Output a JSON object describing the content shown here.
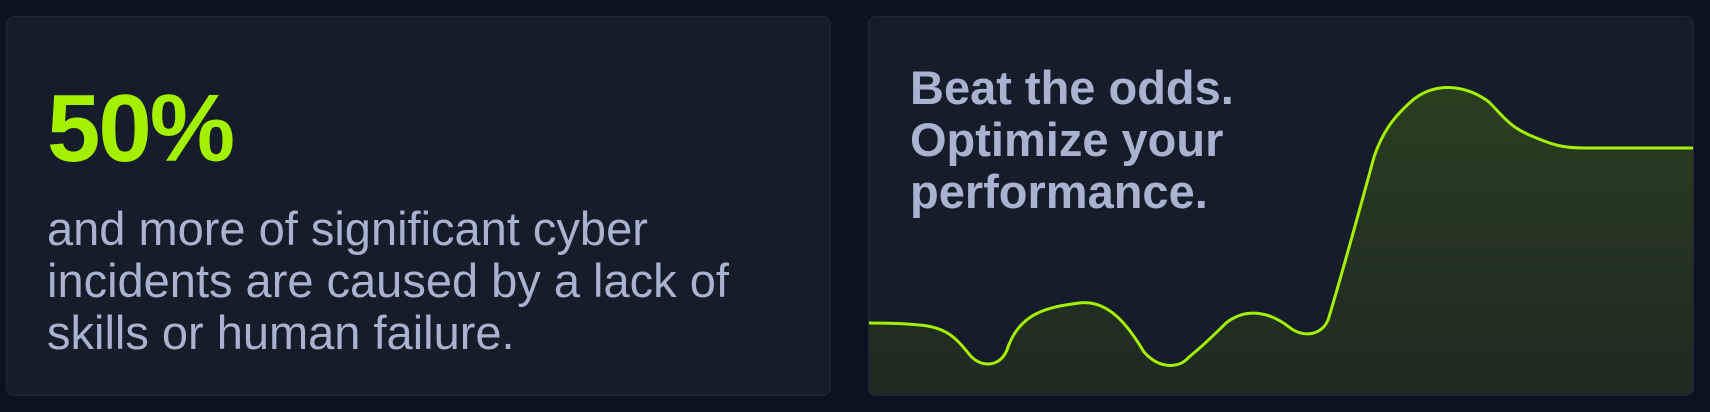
{
  "stat_card": {
    "value": "50%",
    "description": "and more of significant cyber incidents are caused by a lack of skills or human failure."
  },
  "performance_card": {
    "headline": "Beat the odds. Optimize your performance."
  },
  "colors": {
    "background": "#0b1220",
    "card": "#151d2b",
    "accent": "#a3f000",
    "text": "#a8b3cf"
  }
}
